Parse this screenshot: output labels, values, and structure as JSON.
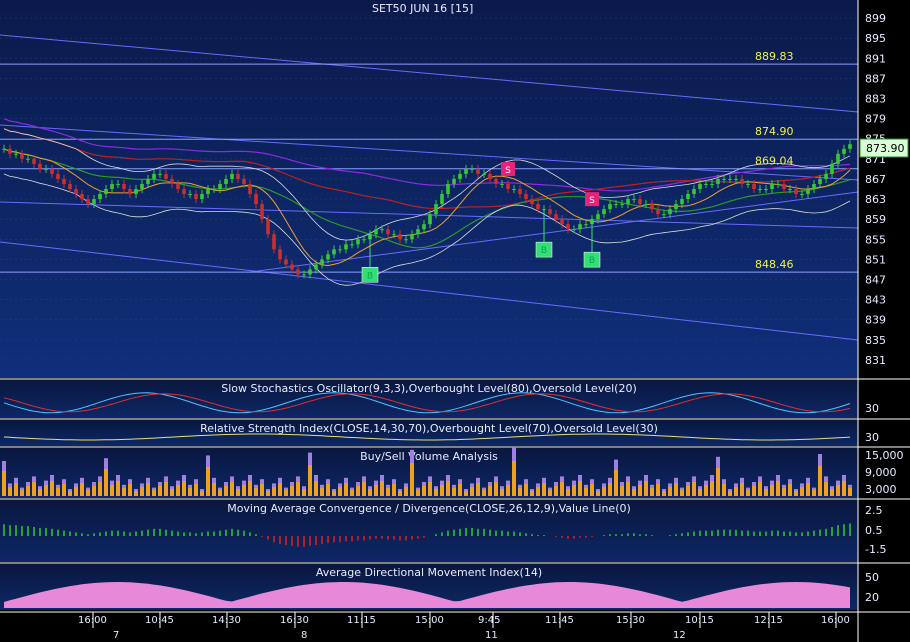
{
  "header": {
    "title": "SET50 JUN 16",
    "interval": "[15]"
  },
  "colors": {
    "bg_top": "#0b1a4a",
    "bg_bottom": "#0f2f7a",
    "grid": "#2a3f8a",
    "text": "#e8ecff",
    "label_yellow": "#f2f04a",
    "price_box": "#d9ffd9",
    "up_candle": "#36c936",
    "down_candle": "#c83030",
    "buy_marker": "#33dd77",
    "sell_marker": "#e8227a",
    "ma_red": "#c02020",
    "ma_purple": "#8a2be2",
    "ma_green": "#2a9a2a",
    "ma_orange": "#f0a030",
    "band": "#dcdcdc",
    "channel": "#6a6aff"
  },
  "chart_data": [
    {
      "type": "candlestick",
      "title": "SET50 JUN 16 [15]",
      "ylim": [
        829,
        901
      ],
      "y_ticks": [
        899,
        895,
        891,
        887,
        883,
        879,
        875,
        871,
        867,
        863,
        859,
        855,
        851,
        847,
        843,
        839,
        835,
        831
      ],
      "last_price": "873.90",
      "level_labels": [
        {
          "label": "889.83",
          "value": 889.83
        },
        {
          "label": "874.90",
          "value": 874.9
        },
        {
          "label": "869.04",
          "value": 869.04
        },
        {
          "label": "848.46",
          "value": 848.46
        }
      ],
      "closes": [
        873,
        872,
        872,
        871,
        871,
        870,
        869,
        869,
        868,
        867,
        866,
        865,
        864,
        863,
        862,
        863,
        864,
        865,
        866,
        866,
        865,
        864,
        865,
        866,
        867,
        868,
        868,
        867,
        866,
        865,
        864,
        864,
        863,
        864,
        865,
        865,
        866,
        867,
        868,
        867,
        866,
        864,
        862,
        859,
        856,
        853,
        851,
        850,
        849,
        848,
        848,
        849,
        850,
        851,
        852,
        853,
        853,
        854,
        854,
        855,
        855,
        856,
        857,
        857,
        856,
        856,
        855,
        855,
        856,
        857,
        858,
        860,
        862,
        864,
        866,
        867,
        868,
        869,
        869,
        868,
        868,
        867,
        866,
        866,
        865,
        865,
        864,
        863,
        862,
        861,
        861,
        860,
        859,
        858,
        857,
        857,
        858,
        858,
        859,
        860,
        861,
        862,
        862,
        862,
        863,
        863,
        862,
        862,
        861,
        860,
        860,
        861,
        862,
        863,
        864,
        865,
        866,
        866,
        866,
        867,
        867,
        867,
        867,
        866,
        866,
        865,
        865,
        865,
        866,
        866,
        865,
        865,
        864,
        864,
        865,
        866,
        867,
        868,
        870,
        872,
        873,
        873.9
      ],
      "buy_markers": [
        {
          "index": 61,
          "label": "B"
        },
        {
          "index": 90,
          "label": "B"
        },
        {
          "index": 98,
          "label": "B"
        }
      ],
      "sell_markers": [
        {
          "index": 84,
          "label": "S"
        },
        {
          "index": 98,
          "label": "S"
        }
      ]
    },
    {
      "type": "line",
      "title": "Slow Stochastics Oscillator(9,3,3),Overbought Level(80),Oversold Level(20)",
      "y_ticks": [
        30
      ]
    },
    {
      "type": "line",
      "title": "Relative Strength Index(CLOSE,14,30,70),Overbought Level(70),Oversold Level(30)",
      "y_ticks": [
        30
      ]
    },
    {
      "type": "bar",
      "title": "Buy/Sell Volume Analysis",
      "y_ticks": [
        "15,000",
        "9,000",
        "3,000"
      ]
    },
    {
      "type": "bar",
      "title": "Moving Average Convergence / Divergence(CLOSE,26,12,9),Value Line(0)",
      "y_ticks": [
        "2.5",
        "0.5",
        "-1.5"
      ]
    },
    {
      "type": "area",
      "title": "Average Directional Movement Index(14)",
      "y_ticks": [
        50,
        20
      ]
    }
  ],
  "x_axis": {
    "time_ticks": [
      "16:00",
      "10:45",
      "14:30",
      "16:30",
      "11:15",
      "15:00",
      "9:45",
      "11:45",
      "15:30",
      "10:15",
      "12:15",
      "16:00"
    ],
    "date_ticks": [
      "7",
      "8",
      "11",
      "12"
    ]
  }
}
